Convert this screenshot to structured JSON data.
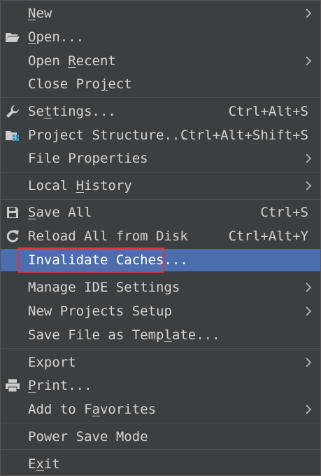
{
  "menu": {
    "items": {
      "new": {
        "pre": "",
        "m": "N",
        "post": "ew",
        "submenu": true
      },
      "open": {
        "pre": "",
        "m": "O",
        "post": "pen...",
        "icon": "folder-open-icon"
      },
      "open_recent": {
        "pre": "Open ",
        "m": "R",
        "post": "ecent",
        "submenu": true
      },
      "close_project": {
        "pre": "Close Pro",
        "m": "j",
        "post": "ect"
      },
      "settings": {
        "pre": "Se",
        "m": "t",
        "post": "tings...",
        "shortcut": "Ctrl+Alt+S",
        "icon": "wrench-icon"
      },
      "project_structure": {
        "label": "Project Structure...",
        "shortcut": "Ctrl+Alt+Shift+S",
        "icon": "project-structure-icon"
      },
      "file_properties": {
        "label": "File Properties",
        "submenu": true
      },
      "local_history": {
        "pre": "Local ",
        "m": "H",
        "post": "istory",
        "submenu": true
      },
      "save_all": {
        "pre": "",
        "m": "S",
        "post": "ave All",
        "shortcut": "Ctrl+S",
        "icon": "save-icon"
      },
      "reload": {
        "label": "Reload All from Disk",
        "shortcut": "Ctrl+Alt+Y",
        "icon": "reload-icon"
      },
      "invalidate_caches": {
        "label": "Invalidate Caches...",
        "selected": true
      },
      "manage_ide_settings": {
        "label": "Manage IDE Settings",
        "submenu": true
      },
      "new_projects_setup": {
        "label": "New Projects Setup",
        "submenu": true
      },
      "save_file_as_template": {
        "pre": "Save File as Temp",
        "m": "l",
        "post": "ate..."
      },
      "export": {
        "label": "Export",
        "submenu": true
      },
      "print": {
        "pre": "",
        "m": "P",
        "post": "rint...",
        "icon": "printer-icon"
      },
      "add_to_favorites": {
        "pre": "Add to F",
        "m": "a",
        "post": "vorites",
        "submenu": true
      },
      "power_save_mode": {
        "label": "Power Save Mode"
      },
      "exit": {
        "pre": "E",
        "m": "x",
        "post": "it"
      }
    }
  },
  "colors": {
    "background": "#3c3f41",
    "selection": "#4b6eaf",
    "highlight_box": "#e0333a",
    "text": "#d4d4d4"
  }
}
